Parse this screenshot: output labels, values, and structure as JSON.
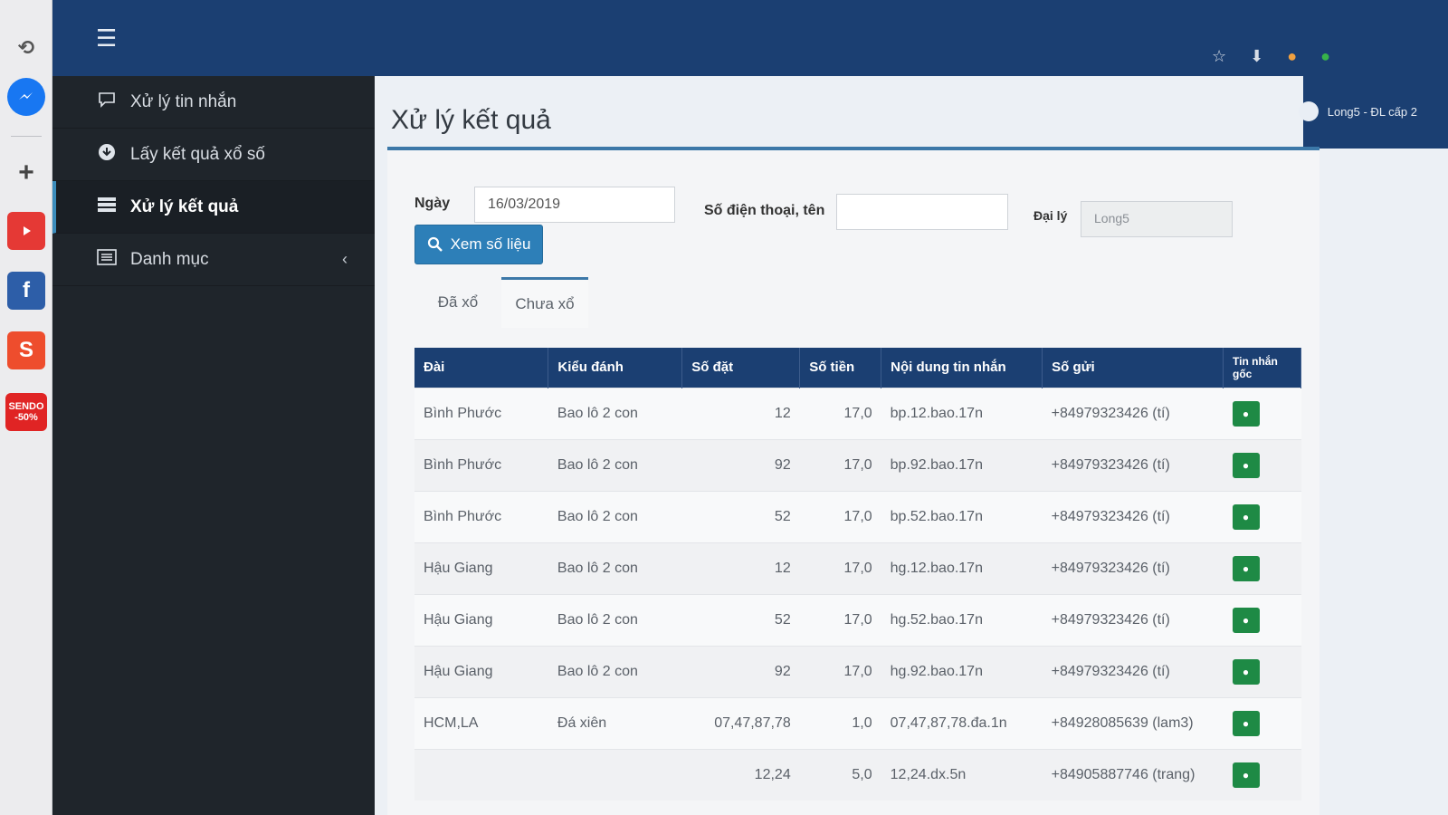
{
  "sidebar": {
    "items": [
      {
        "label": "Xử lý tin nhắn",
        "icon": "chat-bubble-icon"
      },
      {
        "label": "Lấy kết quả xổ số",
        "icon": "download-circle-icon"
      },
      {
        "label": "Xử lý kết quả",
        "icon": "server-list-icon",
        "active": true
      },
      {
        "label": "Danh mục",
        "icon": "list-icon"
      }
    ]
  },
  "header": {
    "page_title": "Xử lý kết quả",
    "user_label": "Long5 - ĐL cấp 2"
  },
  "filters": {
    "date_label": "Ngày",
    "date_value": "16/03/2019",
    "phone_label": "Số điện thoại, tên",
    "phone_value": "",
    "agent_label": "Đại lý",
    "agent_value": "Long5",
    "view_button": "Xem số liệu"
  },
  "tabs": [
    "Đã xổ",
    "Chưa xổ"
  ],
  "table": {
    "headers": [
      "Đài",
      "Kiểu đánh",
      "Số đặt",
      "Số tiền",
      "Nội dung tin nhắn",
      "Số gửi",
      "Tin nhắn gốc"
    ],
    "rows": [
      [
        "Bình Phước",
        "Bao lô 2 con",
        "12",
        "17,0",
        "bp.12.bao.17n",
        "+84979323426 (tí)"
      ],
      [
        "Bình Phước",
        "Bao lô 2 con",
        "92",
        "17,0",
        "bp.92.bao.17n",
        "+84979323426 (tí)"
      ],
      [
        "Bình Phước",
        "Bao lô 2 con",
        "52",
        "17,0",
        "bp.52.bao.17n",
        "+84979323426 (tí)"
      ],
      [
        "Hậu Giang",
        "Bao lô 2 con",
        "12",
        "17,0",
        "hg.12.bao.17n",
        "+84979323426 (tí)"
      ],
      [
        "Hậu Giang",
        "Bao lô 2 con",
        "52",
        "17,0",
        "hg.52.bao.17n",
        "+84979323426 (tí)"
      ],
      [
        "Hậu Giang",
        "Bao lô 2 con",
        "92",
        "17,0",
        "hg.92.bao.17n",
        "+84979323426 (tí)"
      ],
      [
        "HCM,LA",
        "Đá xiên",
        "07,47,87,78",
        "1,0",
        "07,47,87,78.đa.1n",
        "+84928085639 (lam3)"
      ],
      [
        "",
        "",
        "12,24",
        "5,0",
        "12,24.dx.5n",
        "+84905887746 (trang)"
      ]
    ]
  },
  "extensions": [
    "history-icon",
    "messenger-icon",
    "add-icon",
    "youtube-icon",
    "facebook-icon",
    "shopee-icon",
    "sendo-icon"
  ],
  "sendo_badge": "SENDO -50%",
  "colors": {
    "nav": "#1b3f72",
    "sidebar": "#1f252b",
    "accent": "#3c78a8",
    "message_button": "#1e8a45"
  }
}
